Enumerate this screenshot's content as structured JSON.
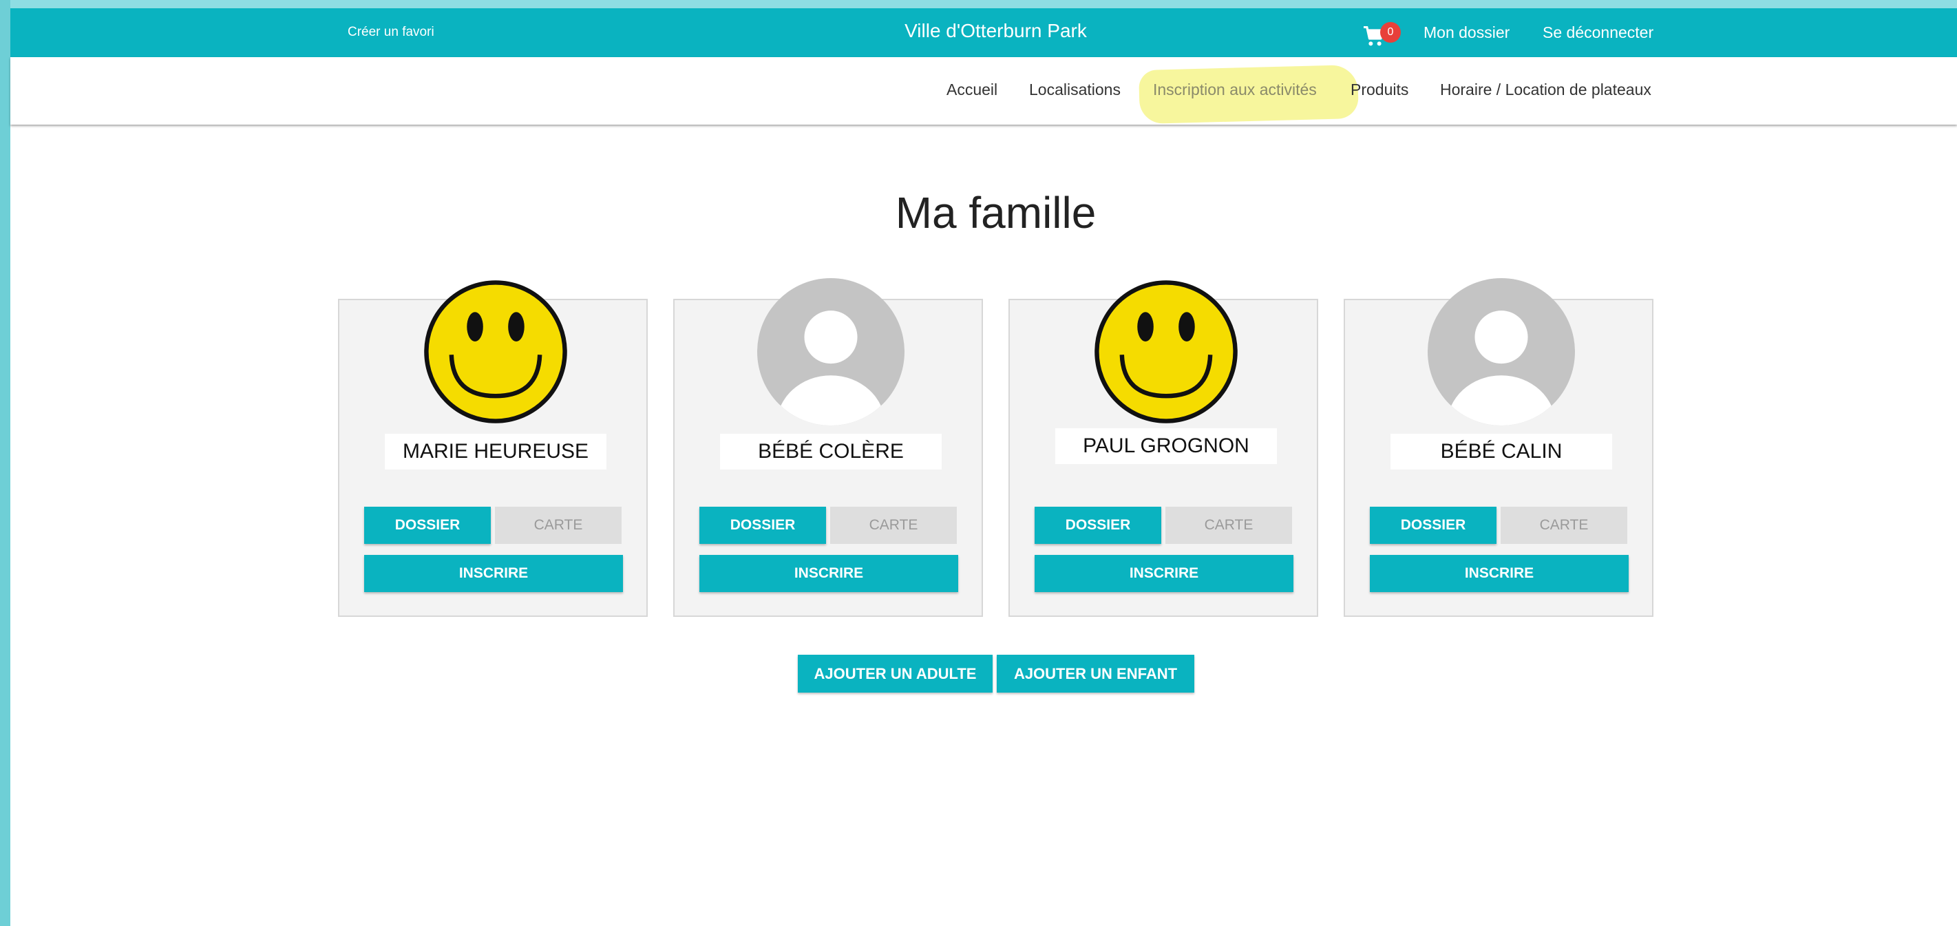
{
  "header": {
    "favorite_link": "Créer un favori",
    "site_title": "Ville d'Otterburn Park",
    "cart_count": "0",
    "cart_icon": "shopping-cart-icon",
    "account_link": "Mon dossier",
    "logout_link": "Se déconnecter"
  },
  "nav": {
    "items": [
      {
        "label": "Accueil"
      },
      {
        "label": "Localisations"
      },
      {
        "label": "Inscription aux activités"
      },
      {
        "label": "Produits"
      },
      {
        "label": "Horaire / Location de plateaux"
      }
    ],
    "highlighted_item": "Inscription aux activités"
  },
  "page": {
    "title": "Ma famille"
  },
  "members": [
    {
      "name": "MARIE HEUREUSE",
      "avatar": "smiley-face-icon",
      "dossier_label": "DOSSIER",
      "carte_label": "CARTE",
      "inscrire_label": "INSCRIRE"
    },
    {
      "name": "BÉBÉ COLÈRE",
      "avatar": "default-user-avatar-icon",
      "dossier_label": "DOSSIER",
      "carte_label": "CARTE",
      "inscrire_label": "INSCRIRE"
    },
    {
      "name": "PAUL GROGNON",
      "avatar": "smiley-face-icon",
      "dossier_label": "DOSSIER",
      "carte_label": "CARTE",
      "inscrire_label": "INSCRIRE"
    },
    {
      "name": "BÉBÉ CALIN",
      "avatar": "default-user-avatar-icon",
      "dossier_label": "DOSSIER",
      "carte_label": "CARTE",
      "inscrire_label": "INSCRIRE"
    }
  ],
  "actions": {
    "add_adult": "AJOUTER UN ADULTE",
    "add_child": "AJOUTER UN ENFANT"
  },
  "colors": {
    "primary": "#0ab3c0",
    "badge": "#e8403a",
    "highlight": "#f6f58c",
    "card_bg": "#f3f3f3",
    "disabled_button": "#dedede"
  }
}
